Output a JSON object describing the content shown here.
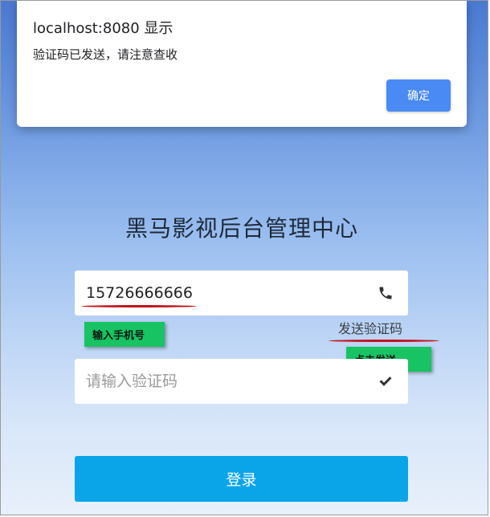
{
  "alert": {
    "title": "localhost:8080 显示",
    "message": "验证码已发送，请注意查收",
    "ok_label": "确定"
  },
  "login": {
    "title": "黑马影视后台管理中心",
    "phone_value": "15726666666",
    "phone_icon": "phone-icon",
    "send_code_label": "发送验证码",
    "code_placeholder": "请输入验证码",
    "code_icon": "check-icon",
    "login_label": "登录"
  },
  "annotations": {
    "phone_note": "输入手机号",
    "send_note": "点击发送",
    "underline_color": "#c1141b",
    "note_color": "#17c363"
  },
  "colors": {
    "dialog_button": "#4a8af4",
    "login_button": "#0aa4e9"
  }
}
